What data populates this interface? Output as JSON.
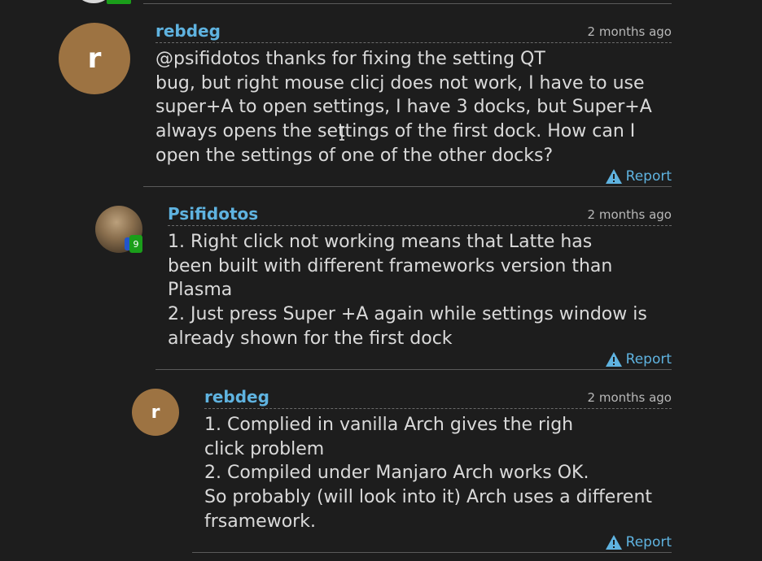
{
  "comments": [
    {
      "author": "rebdeg",
      "avatar_letter": "r",
      "time": "2 months ago",
      "lines": [
        "@psifidotos thanks for fixing the setting QT",
        "bug, but right mouse clicj does not work, I have to use",
        "super+A to open settings, I have 3 docks, but Super+A",
        "always opens the settings of the first dock. How can I",
        "open the settings of one of the other docks?"
      ],
      "report_label": "Report"
    },
    {
      "author": "Psifidotos",
      "badge": "9",
      "time": "2 months ago",
      "lines": [
        "1. Right click not working means that Latte has",
        "been built with different frameworks version than",
        "Plasma",
        "2. Just press Super +A again while settings window is",
        "already shown for the first dock"
      ],
      "report_label": "Report"
    },
    {
      "author": "rebdeg",
      "avatar_letter": "r",
      "time": "2 months ago",
      "lines": [
        "1. Complied in vanilla Arch gives the righ",
        "click problem",
        "2. Compiled under Manjaro Arch works OK.",
        "So probably (will look into it) Arch uses a different",
        "frsamework."
      ],
      "report_label": "Report"
    }
  ],
  "colors": {
    "background": "#1d1d1d",
    "link": "#5fb3e0",
    "text": "#dadada",
    "avatar_letter_bg": "#9d7342",
    "badge_green": "#1a9e1a"
  },
  "icons": [
    "warning-triangle-icon",
    "text-cursor-icon"
  ]
}
